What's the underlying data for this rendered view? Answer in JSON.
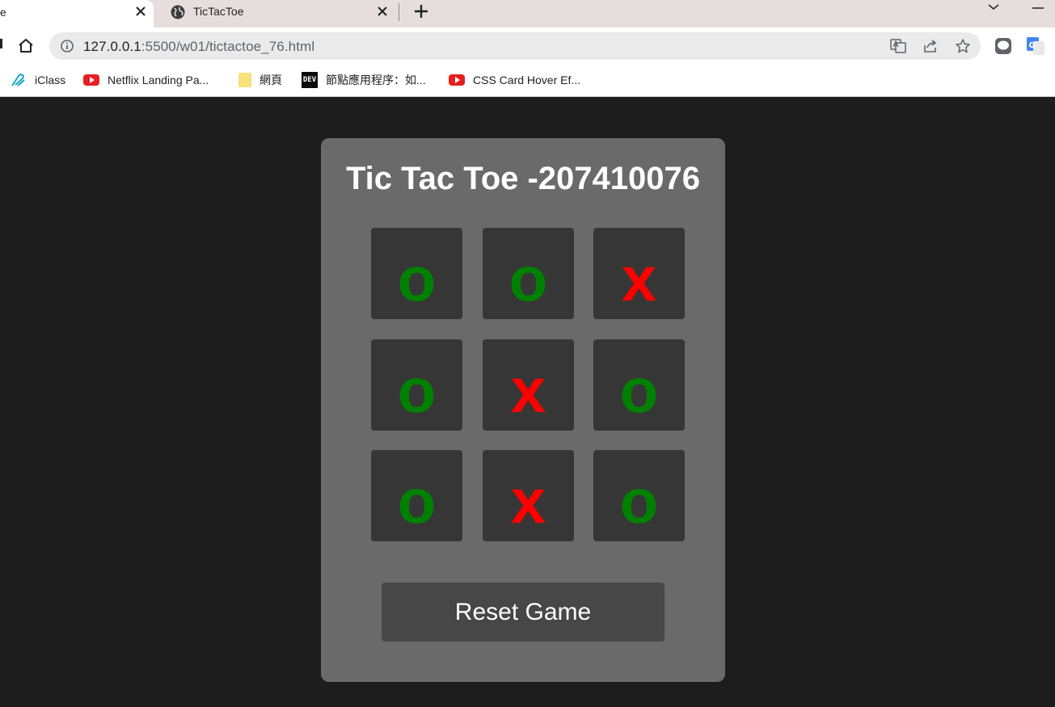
{
  "browser": {
    "tabs": [
      {
        "title": "e",
        "active": true
      },
      {
        "title": "TicTacToe",
        "active": false
      }
    ],
    "address": {
      "host": "127.0.0.1",
      "path": ":5500/w01/tictactoe_76.html"
    },
    "bookmarks": [
      {
        "label": "iClass",
        "icon": "iclass-icon"
      },
      {
        "label": "Netflix Landing Pa...",
        "icon": "youtube-icon"
      },
      {
        "label": "網頁",
        "icon": "folder-icon"
      },
      {
        "label": "節點應用程序：如...",
        "icon": "dev-icon"
      },
      {
        "label": "CSS Card Hover Ef...",
        "icon": "youtube-icon"
      }
    ],
    "dev_badge": "DEV"
  },
  "game": {
    "title": "Tic Tac Toe -207410076",
    "board": [
      "o",
      "o",
      "x",
      "o",
      "x",
      "o",
      "o",
      "x",
      "o"
    ],
    "reset_label": "Reset Game",
    "colors": {
      "o": "#008000",
      "x": "#ff0000",
      "background": "#1e1d1e",
      "card": "#6a6a6a",
      "cell": "#363636",
      "button": "#474747"
    }
  }
}
